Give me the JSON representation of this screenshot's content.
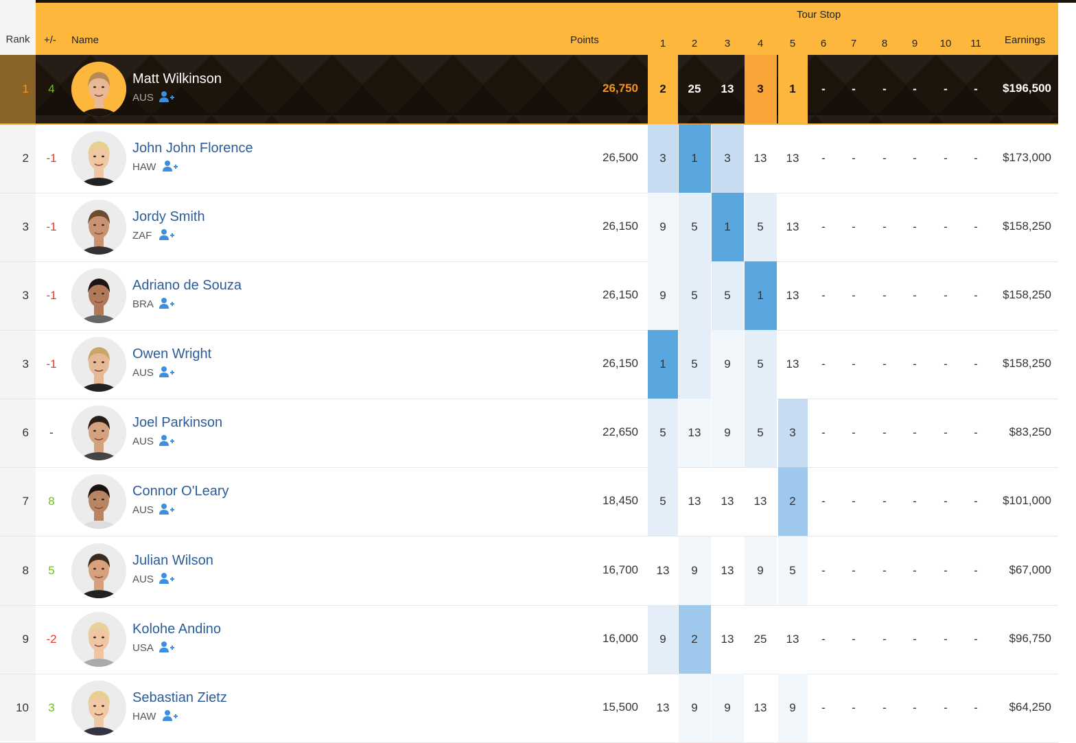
{
  "header": {
    "rank": "Rank",
    "change": "+/-",
    "name": "Name",
    "points": "Points",
    "tour_stop": "Tour Stop",
    "stops": [
      "1",
      "2",
      "3",
      "4",
      "5",
      "6",
      "7",
      "8",
      "9",
      "10",
      "11"
    ],
    "earnings": "Earnings"
  },
  "colors": {
    "header_bg": "#fdb73d",
    "leader_bg": "#1d140c",
    "name_link": "#2b5c9a",
    "positive": "#6cc11b",
    "negative": "#e23a2e",
    "points_leader": "#f7941d"
  },
  "rows": [
    {
      "rank": "1",
      "change": "4",
      "name": "Matt Wilkinson",
      "country": "AUS",
      "points": "26,750",
      "stops": [
        "2",
        "25",
        "13",
        "3",
        "1",
        "-",
        "-",
        "-",
        "-",
        "-",
        "-"
      ],
      "earnings": "$196,500"
    },
    {
      "rank": "2",
      "change": "-1",
      "name": "John John Florence",
      "country": "HAW",
      "points": "26,500",
      "stops": [
        "3",
        "1",
        "3",
        "13",
        "13",
        "-",
        "-",
        "-",
        "-",
        "-",
        "-"
      ],
      "earnings": "$173,000"
    },
    {
      "rank": "3",
      "change": "-1",
      "name": "Jordy Smith",
      "country": "ZAF",
      "points": "26,150",
      "stops": [
        "9",
        "5",
        "1",
        "5",
        "13",
        "-",
        "-",
        "-",
        "-",
        "-",
        "-"
      ],
      "earnings": "$158,250"
    },
    {
      "rank": "3",
      "change": "-1",
      "name": "Adriano de Souza",
      "country": "BRA",
      "points": "26,150",
      "stops": [
        "9",
        "5",
        "5",
        "1",
        "13",
        "-",
        "-",
        "-",
        "-",
        "-",
        "-"
      ],
      "earnings": "$158,250"
    },
    {
      "rank": "3",
      "change": "-1",
      "name": "Owen Wright",
      "country": "AUS",
      "points": "26,150",
      "stops": [
        "1",
        "5",
        "9",
        "5",
        "13",
        "-",
        "-",
        "-",
        "-",
        "-",
        "-"
      ],
      "earnings": "$158,250"
    },
    {
      "rank": "6",
      "change": "-",
      "name": "Joel Parkinson",
      "country": "AUS",
      "points": "22,650",
      "stops": [
        "5",
        "13",
        "9",
        "5",
        "3",
        "-",
        "-",
        "-",
        "-",
        "-",
        "-"
      ],
      "earnings": "$83,250"
    },
    {
      "rank": "7",
      "change": "8",
      "name": "Connor O'Leary",
      "country": "AUS",
      "points": "18,450",
      "stops": [
        "5",
        "13",
        "13",
        "13",
        "2",
        "-",
        "-",
        "-",
        "-",
        "-",
        "-"
      ],
      "earnings": "$101,000"
    },
    {
      "rank": "8",
      "change": "5",
      "name": "Julian Wilson",
      "country": "AUS",
      "points": "16,700",
      "stops": [
        "13",
        "9",
        "13",
        "9",
        "5",
        "-",
        "-",
        "-",
        "-",
        "-",
        "-"
      ],
      "earnings": "$67,000"
    },
    {
      "rank": "9",
      "change": "-2",
      "name": "Kolohe Andino",
      "country": "USA",
      "points": "16,000",
      "stops": [
        "9",
        "2",
        "13",
        "25",
        "13",
        "-",
        "-",
        "-",
        "-",
        "-",
        "-"
      ],
      "earnings": "$96,750"
    },
    {
      "rank": "10",
      "change": "3",
      "name": "Sebastian Zietz",
      "country": "HAW",
      "points": "15,500",
      "stops": [
        "13",
        "9",
        "9",
        "13",
        "9",
        "-",
        "-",
        "-",
        "-",
        "-",
        "-"
      ],
      "earnings": "$64,250"
    }
  ]
}
